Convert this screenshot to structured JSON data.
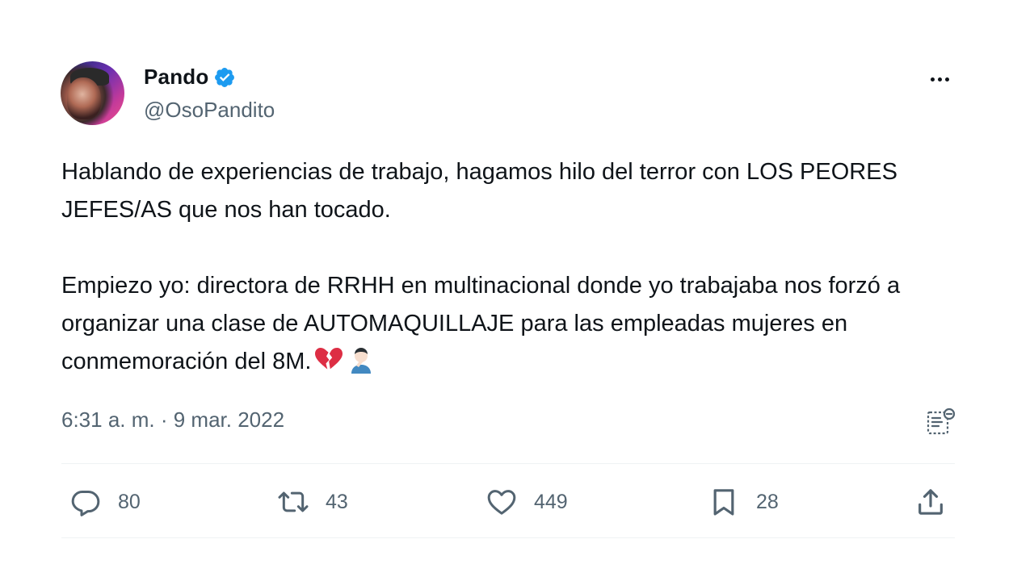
{
  "author": {
    "display_name": "Pando",
    "handle": "@OsoPandito",
    "verified": true
  },
  "tweet": {
    "text": "Hablando de experiencias de trabajo, hagamos hilo del terror con LOS PEORES JEFES/AS que nos han tocado.\n\nEmpiezo yo: directora de RRHH en multinacional donde yo trabajaba nos forzó a organizar una clase de AUTOMAQUILLAJE para las empleadas mujeres en conmemoración del 8M.",
    "emojis": [
      "broken-heart",
      "man-facepalming"
    ],
    "timestamp": "6:31 a. m. · 9 mar. 2022"
  },
  "actions": {
    "replies": "80",
    "retweets": "43",
    "likes": "449",
    "bookmarks": "28"
  },
  "icons": {
    "more": "more-horizontal-icon",
    "views": "view-analytics-icon",
    "reply": "reply-icon",
    "retweet": "retweet-icon",
    "like": "heart-icon",
    "bookmark": "bookmark-icon",
    "share": "share-icon"
  },
  "colors": {
    "text": "#0f1419",
    "secondary": "#536471",
    "verified_blue": "#1d9bf0",
    "divider": "#eff3f4"
  }
}
